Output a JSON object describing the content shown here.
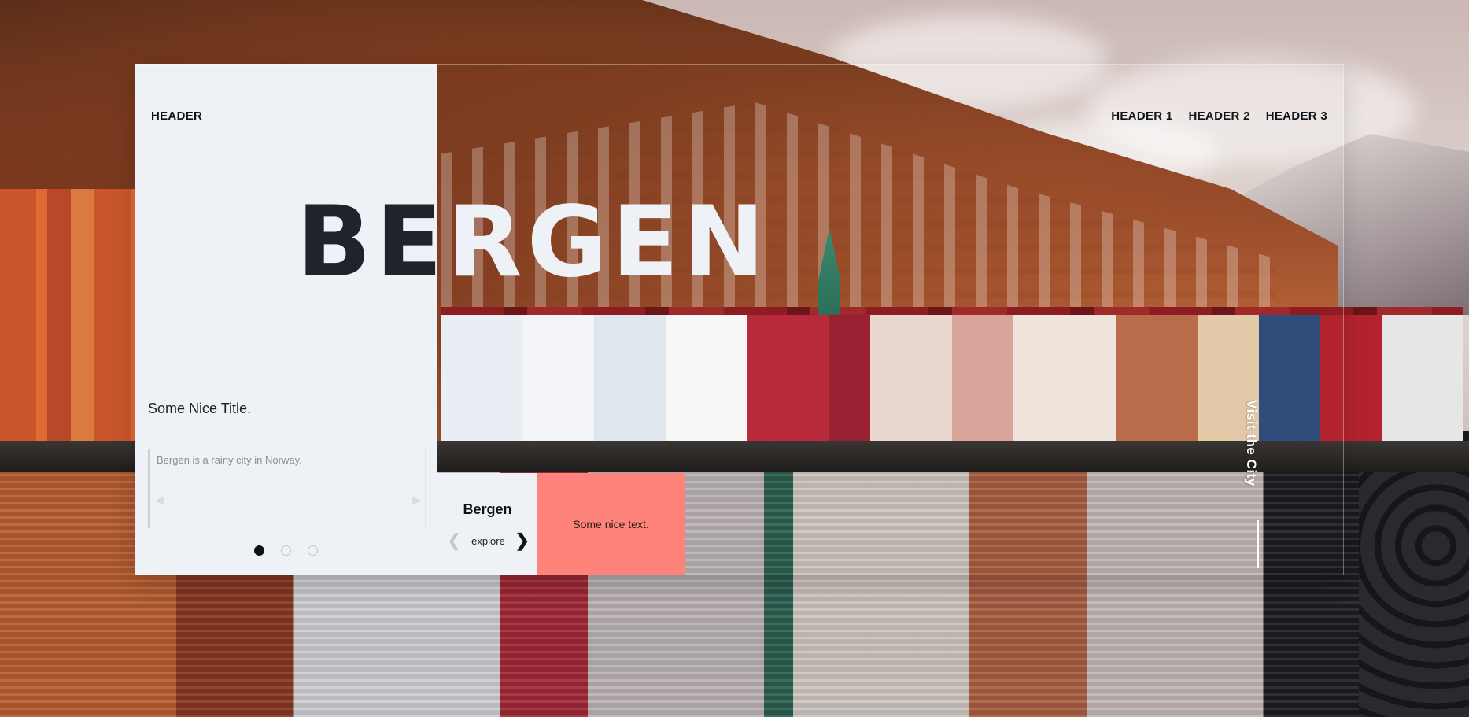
{
  "header": {
    "brand": "HEADER",
    "nav": [
      "HEADER 1",
      "HEADER 2",
      "HEADER 3"
    ]
  },
  "hero": {
    "title_dark": "BE",
    "title_light": "RGEN"
  },
  "slide": {
    "title": "Some Nice Title.",
    "quote": "Bergen is a rainy city in Norway.",
    "prev_icon": "chevron-left-icon",
    "next_icon": "chevron-right-icon",
    "dots": 3,
    "active_dot": 1
  },
  "city_tile": {
    "name": "Bergen",
    "explore_label": "explore",
    "prev_icon": "chevron-left-icon",
    "next_icon": "chevron-right-icon"
  },
  "note_tile": {
    "text": "Some nice text."
  },
  "side_link": {
    "label": "Visit the City"
  },
  "colors": {
    "panel": "#eef2f6",
    "accent": "#fd837b",
    "ink": "#0f141a",
    "title_dark": "#1f232a"
  }
}
